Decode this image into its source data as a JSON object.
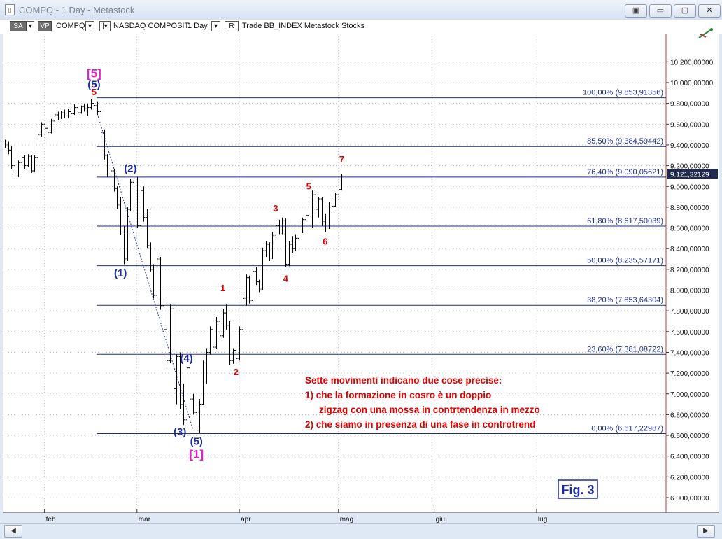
{
  "window": {
    "title": "COMPQ - 1 Day - Metastock",
    "buttons": [
      "▣",
      "▭",
      "▢",
      "✕"
    ]
  },
  "toolbar": {
    "sa": "SA",
    "vp": "VP",
    "symbol": "COMPQ",
    "name": "NASDAQ COMPOSIT",
    "period": "1 Day",
    "r": "R",
    "rest": "Trade  BB_INDEX  Metastock  Stocks"
  },
  "icons": {
    "app": "document-icon",
    "chart_tool": "chart-tool-icon",
    "scroll_left": "scroll-left-icon",
    "scroll_right": "scroll-right-icon"
  },
  "colors": {
    "fib_line": "#1c2d8c",
    "bar": "#000000",
    "red_label": "#e00000",
    "blue_label": "#1c2aa6",
    "magenta_label": "#e020c8",
    "price_box": "#1f2a4c",
    "axis_text": "#111111"
  },
  "chart_data": {
    "type": "ohlc",
    "title": "COMPQ - 1 Day",
    "ylim": [
      5850000,
      10500000
    ],
    "y_ticks": [
      {
        "v": 6000000,
        "label": "6.000,00000"
      },
      {
        "v": 6200000,
        "label": "6.200,00000"
      },
      {
        "v": 6400000,
        "label": "6.400,00000"
      },
      {
        "v": 6600000,
        "label": "6.600,00000"
      },
      {
        "v": 6800000,
        "label": "6.800,00000"
      },
      {
        "v": 7000000,
        "label": "7.000,00000"
      },
      {
        "v": 7200000,
        "label": "7.200,00000"
      },
      {
        "v": 7400000,
        "label": "7.400,00000"
      },
      {
        "v": 7600000,
        "label": "7.600,00000"
      },
      {
        "v": 7800000,
        "label": "7.800,00000"
      },
      {
        "v": 8000000,
        "label": "8.000,00000"
      },
      {
        "v": 8200000,
        "label": "8.200,00000"
      },
      {
        "v": 8400000,
        "label": "8.400,00000"
      },
      {
        "v": 8600000,
        "label": "8.600,00000"
      },
      {
        "v": 8800000,
        "label": "8.800,00000"
      },
      {
        "v": 9000000,
        "label": "9.000,00000"
      },
      {
        "v": 9200000,
        "label": "9.200,00000"
      },
      {
        "v": 9400000,
        "label": "9.400,00000"
      },
      {
        "v": 9600000,
        "label": "9.600,00000"
      },
      {
        "v": 9800000,
        "label": "9.800,00000"
      },
      {
        "v": 10000000,
        "label": "10.000,00000"
      },
      {
        "v": 10200000,
        "label": "10.200,00000"
      }
    ],
    "x_labels": [
      {
        "bar": 12,
        "label": "feb"
      },
      {
        "bar": 40,
        "label": "mar"
      },
      {
        "bar": 71,
        "label": "apr"
      },
      {
        "bar": 101,
        "label": "mag"
      },
      {
        "bar": 130,
        "label": "giu"
      },
      {
        "bar": 161,
        "label": "lug"
      }
    ],
    "last_price": {
      "v": 9121321,
      "label": "9.121,32129"
    },
    "fib_levels": [
      {
        "v": 9853914,
        "label": "100,00% (9.853,91356)"
      },
      {
        "v": 9384594,
        "label": "85,50% (9.384,59442)"
      },
      {
        "v": 9090056,
        "label": "76,40% (9.090,05621)"
      },
      {
        "v": 8617500,
        "label": "61,80% (8.617,50039)"
      },
      {
        "v": 8235572,
        "label": "50,00% (8.235,57171)"
      },
      {
        "v": 7853643,
        "label": "38,20% (7.853,64304)"
      },
      {
        "v": 7381087,
        "label": "23,60% (7.381,08722)"
      },
      {
        "v": 6617230,
        "label": "0,00% (6.617,22987)"
      }
    ],
    "fib_start_bar": 28,
    "ohlc": [
      [
        0,
        9410000,
        9450000,
        9370000,
        9400000
      ],
      [
        1,
        9400000,
        9430000,
        9310000,
        9350000
      ],
      [
        2,
        9350000,
        9390000,
        9170000,
        9200000
      ],
      [
        3,
        9200000,
        9240000,
        9080000,
        9100000
      ],
      [
        4,
        9100000,
        9250000,
        9090000,
        9230000
      ],
      [
        5,
        9230000,
        9310000,
        9210000,
        9280000
      ],
      [
        6,
        9280000,
        9300000,
        9170000,
        9200000
      ],
      [
        7,
        9200000,
        9310000,
        9190000,
        9290000
      ],
      [
        8,
        9290000,
        9300000,
        9130000,
        9150000
      ],
      [
        9,
        9150000,
        9300000,
        9140000,
        9280000
      ],
      [
        10,
        9280000,
        9510000,
        9270000,
        9500000
      ],
      [
        11,
        9500000,
        9620000,
        9480000,
        9600000
      ],
      [
        12,
        9600000,
        9640000,
        9530000,
        9560000
      ],
      [
        13,
        9560000,
        9600000,
        9490000,
        9520000
      ],
      [
        14,
        9520000,
        9650000,
        9510000,
        9630000
      ],
      [
        15,
        9630000,
        9710000,
        9610000,
        9690000
      ],
      [
        16,
        9690000,
        9720000,
        9640000,
        9660000
      ],
      [
        17,
        9660000,
        9730000,
        9650000,
        9710000
      ],
      [
        18,
        9710000,
        9740000,
        9660000,
        9680000
      ],
      [
        19,
        9680000,
        9750000,
        9660000,
        9720000
      ],
      [
        20,
        9720000,
        9760000,
        9680000,
        9700000
      ],
      [
        21,
        9700000,
        9790000,
        9690000,
        9760000
      ],
      [
        22,
        9760000,
        9800000,
        9700000,
        9710000
      ],
      [
        23,
        9710000,
        9780000,
        9700000,
        9770000
      ],
      [
        24,
        9770000,
        9790000,
        9720000,
        9750000
      ],
      [
        25,
        9750000,
        9800000,
        9680000,
        9760000
      ],
      [
        26,
        9760000,
        9840000,
        9740000,
        9800000
      ],
      [
        27,
        9800000,
        9854000,
        9760000,
        9780000
      ],
      [
        28,
        9780000,
        9820000,
        9690000,
        9720000
      ],
      [
        29,
        9720000,
        9740000,
        9480000,
        9520000
      ],
      [
        30,
        9520000,
        9550000,
        9260000,
        9300000
      ],
      [
        31,
        9300000,
        9310000,
        9090000,
        9120000
      ],
      [
        32,
        9120000,
        9250000,
        9080000,
        9150000
      ],
      [
        33,
        9150000,
        9170000,
        8950000,
        8980000
      ],
      [
        34,
        8980000,
        9000000,
        8780000,
        8820000
      ],
      [
        35,
        8820000,
        8900000,
        8530000,
        8560000
      ],
      [
        36,
        8560000,
        8620000,
        8250000,
        8300000
      ],
      [
        37,
        8300000,
        8800000,
        8280000,
        8780000
      ],
      [
        38,
        8780000,
        9070000,
        8760000,
        9040000
      ],
      [
        39,
        9040000,
        9100000,
        8800000,
        8850000
      ],
      [
        40,
        8850000,
        9090000,
        8600000,
        8620000
      ],
      [
        41,
        8620000,
        9040000,
        8600000,
        8960000
      ],
      [
        42,
        8960000,
        9000000,
        8660000,
        8700000
      ],
      [
        43,
        8700000,
        8780000,
        8400000,
        8430000
      ],
      [
        44,
        8430000,
        8460000,
        8180000,
        8200000
      ],
      [
        45,
        8200000,
        8250000,
        7920000,
        7950000
      ],
      [
        46,
        7950000,
        8350000,
        7920000,
        8300000
      ],
      [
        47,
        8300000,
        8320000,
        7810000,
        7850000
      ],
      [
        48,
        7850000,
        7900000,
        7580000,
        7620000
      ],
      [
        49,
        7620000,
        7650000,
        7280000,
        7320000
      ],
      [
        50,
        7320000,
        7860000,
        7300000,
        7820000
      ],
      [
        51,
        7820000,
        7840000,
        7000000,
        7050000
      ],
      [
        52,
        7050000,
        7380000,
        6900000,
        7360000
      ],
      [
        53,
        7360000,
        7400000,
        6850000,
        6900000
      ],
      [
        54,
        6900000,
        7100000,
        6700000,
        6750000
      ],
      [
        55,
        6750000,
        7280000,
        6740000,
        7250000
      ],
      [
        56,
        7250000,
        7340000,
        6900000,
        6950000
      ],
      [
        57,
        6950000,
        7000000,
        6800000,
        6820000
      ],
      [
        58,
        6820000,
        6900000,
        6617000,
        6650000
      ],
      [
        59,
        6650000,
        6950000,
        6620000,
        6900000
      ],
      [
        60,
        6900000,
        7320000,
        6890000,
        7300000
      ],
      [
        61,
        7300000,
        7440000,
        7100000,
        7400000
      ],
      [
        62,
        7400000,
        7650000,
        7380000,
        7620000
      ],
      [
        63,
        7620000,
        7700000,
        7400000,
        7450000
      ],
      [
        64,
        7450000,
        7740000,
        7430000,
        7700000
      ],
      [
        65,
        7700000,
        7750000,
        7520000,
        7560000
      ],
      [
        66,
        7560000,
        7820000,
        7540000,
        7780000
      ],
      [
        67,
        7780000,
        7860000,
        7620000,
        7660000
      ],
      [
        68,
        7660000,
        7700000,
        7280000,
        7320000
      ],
      [
        69,
        7320000,
        7440000,
        7290000,
        7420000
      ],
      [
        70,
        7420000,
        7460000,
        7300000,
        7340000
      ],
      [
        71,
        7340000,
        7650000,
        7320000,
        7620000
      ],
      [
        72,
        7620000,
        7950000,
        7600000,
        7920000
      ],
      [
        73,
        7920000,
        8150000,
        7850000,
        8120000
      ],
      [
        74,
        8120000,
        8140000,
        7870000,
        7900000
      ],
      [
        75,
        7900000,
        8210000,
        7880000,
        8180000
      ],
      [
        76,
        8180000,
        8220000,
        8050000,
        8080000
      ],
      [
        77,
        8080000,
        8100000,
        7980000,
        8010000
      ],
      [
        78,
        8010000,
        8410000,
        8000000,
        8380000
      ],
      [
        79,
        8380000,
        8470000,
        8320000,
        8440000
      ],
      [
        80,
        8440000,
        8460000,
        8280000,
        8310000
      ],
      [
        81,
        8310000,
        8560000,
        8300000,
        8530000
      ],
      [
        82,
        8530000,
        8650000,
        8500000,
        8620000
      ],
      [
        83,
        8620000,
        8680000,
        8540000,
        8560000
      ],
      [
        84,
        8560000,
        8700000,
        8540000,
        8670000
      ],
      [
        85,
        8670000,
        8690000,
        8220000,
        8250000
      ],
      [
        86,
        8250000,
        8470000,
        8230000,
        8440000
      ],
      [
        87,
        8440000,
        8520000,
        8360000,
        8400000
      ],
      [
        88,
        8400000,
        8540000,
        8380000,
        8500000
      ],
      [
        89,
        8500000,
        8640000,
        8480000,
        8600000
      ],
      [
        90,
        8600000,
        8700000,
        8550000,
        8680000
      ],
      [
        91,
        8680000,
        8740000,
        8630000,
        8720000
      ],
      [
        92,
        8720000,
        8860000,
        8700000,
        8830000
      ],
      [
        93,
        8830000,
        8960000,
        8600000,
        8920000
      ],
      [
        94,
        8920000,
        8950000,
        8760000,
        8780000
      ],
      [
        95,
        8780000,
        8900000,
        8700000,
        8880000
      ],
      [
        96,
        8880000,
        8900000,
        8620000,
        8660000
      ],
      [
        97,
        8660000,
        8740000,
        8560000,
        8600000
      ],
      [
        98,
        8600000,
        8850000,
        8590000,
        8830000
      ],
      [
        99,
        8830000,
        8880000,
        8780000,
        8810000
      ],
      [
        100,
        8810000,
        8940000,
        8800000,
        8920000
      ],
      [
        101,
        8920000,
        8990000,
        8880000,
        8970000
      ],
      [
        102,
        8970000,
        9121000,
        8960000,
        9100000
      ]
    ],
    "wave_labels": [
      {
        "bar": 27,
        "v": 10050000,
        "text": "[5]",
        "color": "magenta"
      },
      {
        "bar": 27,
        "v": 9950000,
        "text": "(5)",
        "color": "blue"
      },
      {
        "bar": 27,
        "v": 9880000,
        "text": "5",
        "color": "red"
      },
      {
        "bar": 38,
        "v": 9140000,
        "text": "(2)",
        "color": "blue"
      },
      {
        "bar": 35,
        "v": 8130000,
        "text": "(1)",
        "color": "blue"
      },
      {
        "bar": 55,
        "v": 7310000,
        "text": "(4)",
        "color": "blue"
      },
      {
        "bar": 53,
        "v": 6600000,
        "text": "(3)",
        "color": "blue"
      },
      {
        "bar": 58,
        "v": 6510000,
        "text": "(5)",
        "color": "blue"
      },
      {
        "bar": 58,
        "v": 6380000,
        "text": "[1]",
        "color": "magenta"
      },
      {
        "bar": 66,
        "v": 7990000,
        "text": "1",
        "color": "red"
      },
      {
        "bar": 70,
        "v": 7180000,
        "text": "2",
        "color": "red"
      },
      {
        "bar": 82,
        "v": 8760000,
        "text": "3",
        "color": "red"
      },
      {
        "bar": 85,
        "v": 8080000,
        "text": "4",
        "color": "red"
      },
      {
        "bar": 92,
        "v": 8970000,
        "text": "5",
        "color": "red"
      },
      {
        "bar": 97,
        "v": 8440000,
        "text": "6",
        "color": "red"
      },
      {
        "bar": 102,
        "v": 9230000,
        "text": "7",
        "color": "red"
      }
    ],
    "annotation_lines": [
      {
        "text": "Sette movimenti indicano due cose precise:",
        "indent": 0
      },
      {
        "text": "1) che la formazione in cosro è un doppio",
        "indent": 0
      },
      {
        "text": "zigzag con una mossa in contrtendenza in mezzo",
        "indent": 20
      },
      {
        "text": "2) che siamo in presenza di una fase in controtrend",
        "indent": 0
      }
    ],
    "fig_label": "Fig. 3",
    "trendline": {
      "from_bar": 28,
      "from_v": 9700000,
      "to_bar": 57,
      "to_v": 6650000
    }
  }
}
